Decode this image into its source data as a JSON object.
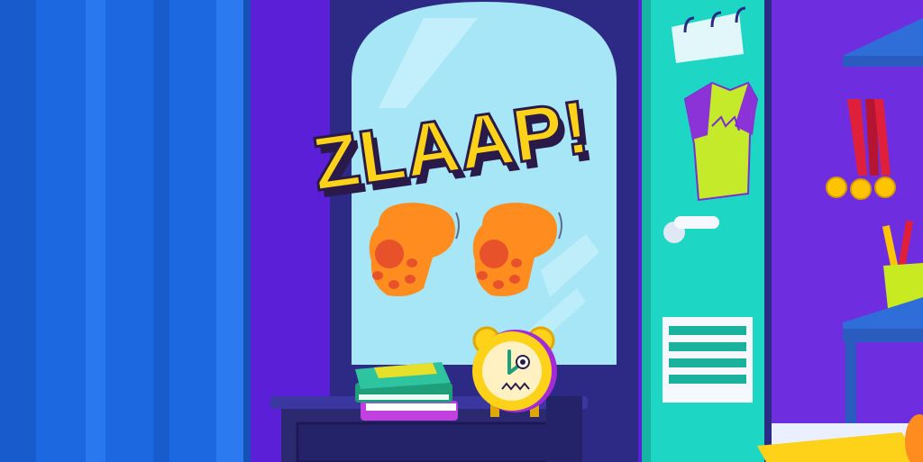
{
  "scene": {
    "title_text": "ZLAAP!",
    "colors": {
      "curtain": "#1c68e0",
      "wall": "#5a1fd6",
      "mirror_frame": "#2c2a85",
      "mirror_glass": "#a6e6f7",
      "dresser": "#2b2a70",
      "locker": "#1ed6c4",
      "title_fill": "#ffd21a",
      "title_outline": "#2a1a4a",
      "paw": "#ff8c1f",
      "paw_pad": "#e8522a",
      "clock": "#ffd21a",
      "shirt": "#c5ea2a",
      "shelf": "#2f6dd8"
    },
    "icons": {
      "clock": "alarm-clock-icon",
      "paws": "paw-icon",
      "medals": "medal-icon",
      "shirt": "tshirt-icon"
    }
  }
}
